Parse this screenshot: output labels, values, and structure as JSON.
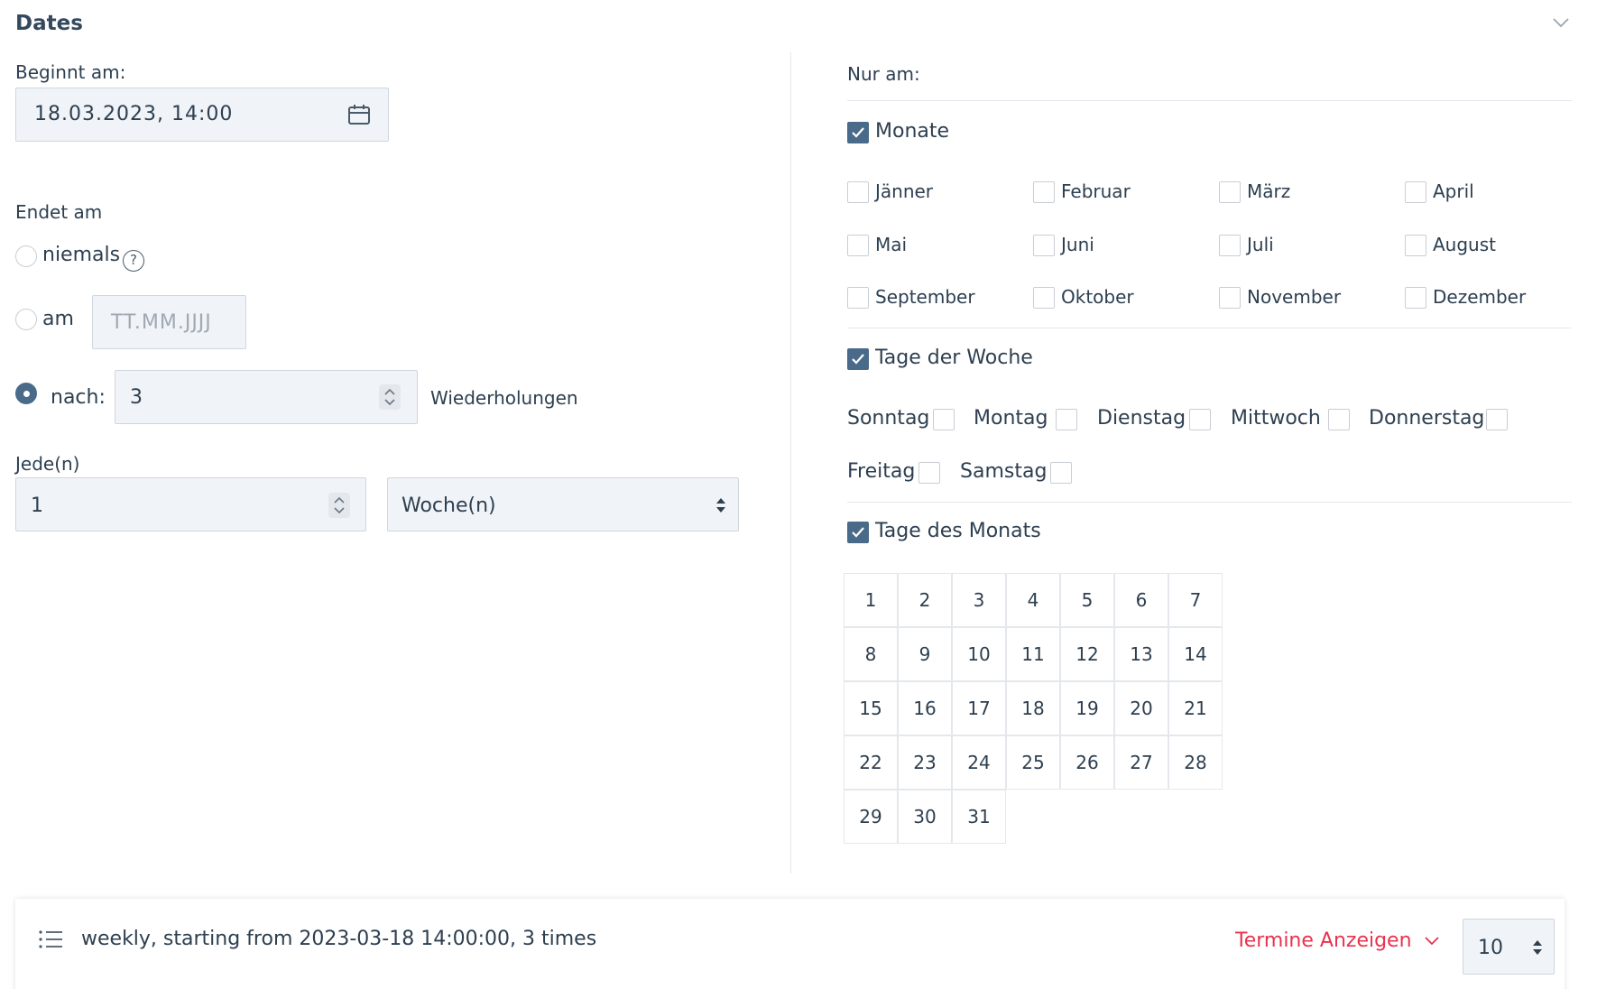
{
  "section": {
    "title": "Dates"
  },
  "start": {
    "label": "Beginnt am:",
    "value": "18.03.2023, 14:00"
  },
  "end": {
    "label": "Endet am",
    "never_label": "niemals",
    "help_glyph": "?",
    "on_label": "am",
    "on_placeholder": "TT.MM.JJJJ",
    "after_label": "nach:",
    "after_value": "3",
    "after_unit": "Wiederholungen",
    "selected": "after"
  },
  "interval": {
    "label": "Jede(n)",
    "value": "1",
    "unit": "Woche(n)"
  },
  "only_on": {
    "label": "Nur am:",
    "months": {
      "label": "Monate",
      "checked": true,
      "items": [
        "Jänner",
        "Februar",
        "März",
        "April",
        "Mai",
        "Juni",
        "Juli",
        "August",
        "September",
        "Oktober",
        "November",
        "Dezember"
      ]
    },
    "weekdays": {
      "label": "Tage der Woche",
      "checked": true,
      "items": [
        "Sonntag",
        "Montag",
        "Dienstag",
        "Mittwoch",
        "Donnerstag",
        "Freitag",
        "Samstag"
      ]
    },
    "monthdays": {
      "label": "Tage des Monats",
      "checked": true,
      "items": [
        "1",
        "2",
        "3",
        "4",
        "5",
        "6",
        "7",
        "8",
        "9",
        "10",
        "11",
        "12",
        "13",
        "14",
        "15",
        "16",
        "17",
        "18",
        "19",
        "20",
        "21",
        "22",
        "23",
        "24",
        "25",
        "26",
        "27",
        "28",
        "29",
        "30",
        "31"
      ]
    }
  },
  "summary": {
    "text": "weekly, starting from 2023-03-18 14:00:00, 3 times",
    "show_label": "Termine Anzeigen",
    "count": "10",
    "accent_color": "#e8334f"
  },
  "icons": {
    "collapse": "chevron-down-icon",
    "calendar": "calendar-icon",
    "help": "help-icon",
    "list": "list-icon"
  }
}
